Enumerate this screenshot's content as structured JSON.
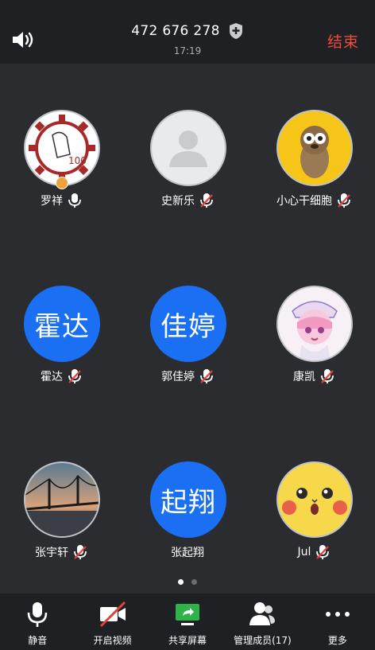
{
  "header": {
    "meeting_id": "472 676 278",
    "timer": "17:19",
    "end_label": "结束"
  },
  "participants": [
    {
      "name": "罗祥",
      "avatar_type": "image",
      "avatar_desc": "logo-image",
      "mic": "on",
      "host": true
    },
    {
      "name": "史新乐",
      "avatar_type": "placeholder",
      "mic": "muted"
    },
    {
      "name": "小心干细胞",
      "avatar_type": "image",
      "avatar_desc": "cartoon-lemur",
      "mic": "muted"
    },
    {
      "name": "霍达",
      "avatar_type": "text",
      "avatar_text": "霍达",
      "mic": "muted"
    },
    {
      "name": "郭佳婷",
      "avatar_type": "text",
      "avatar_text": "佳婷",
      "mic": "muted"
    },
    {
      "name": "康凯",
      "avatar_type": "image",
      "avatar_desc": "anime-character",
      "mic": "muted"
    },
    {
      "name": "张宇轩",
      "avatar_type": "image",
      "avatar_desc": "bridge-photo",
      "mic": "muted"
    },
    {
      "name": "张起翔",
      "avatar_type": "text",
      "avatar_text": "起翔",
      "mic": "none"
    },
    {
      "name": "Jul",
      "avatar_type": "image",
      "avatar_desc": "pikachu",
      "mic": "muted"
    }
  ],
  "pager": {
    "pages": 2,
    "current": 1
  },
  "toolbar": {
    "mute_label": "静音",
    "video_label": "开启视频",
    "share_label": "共享屏幕",
    "members_label": "管理成员(17)",
    "more_label": "更多"
  },
  "colors": {
    "background": "#2b2c30",
    "bar": "#1f2023",
    "accent_blue": "#1a6ff2",
    "end_red": "#ee4b3c",
    "share_green": "#2fb24a",
    "muted_red": "#e2413a"
  }
}
